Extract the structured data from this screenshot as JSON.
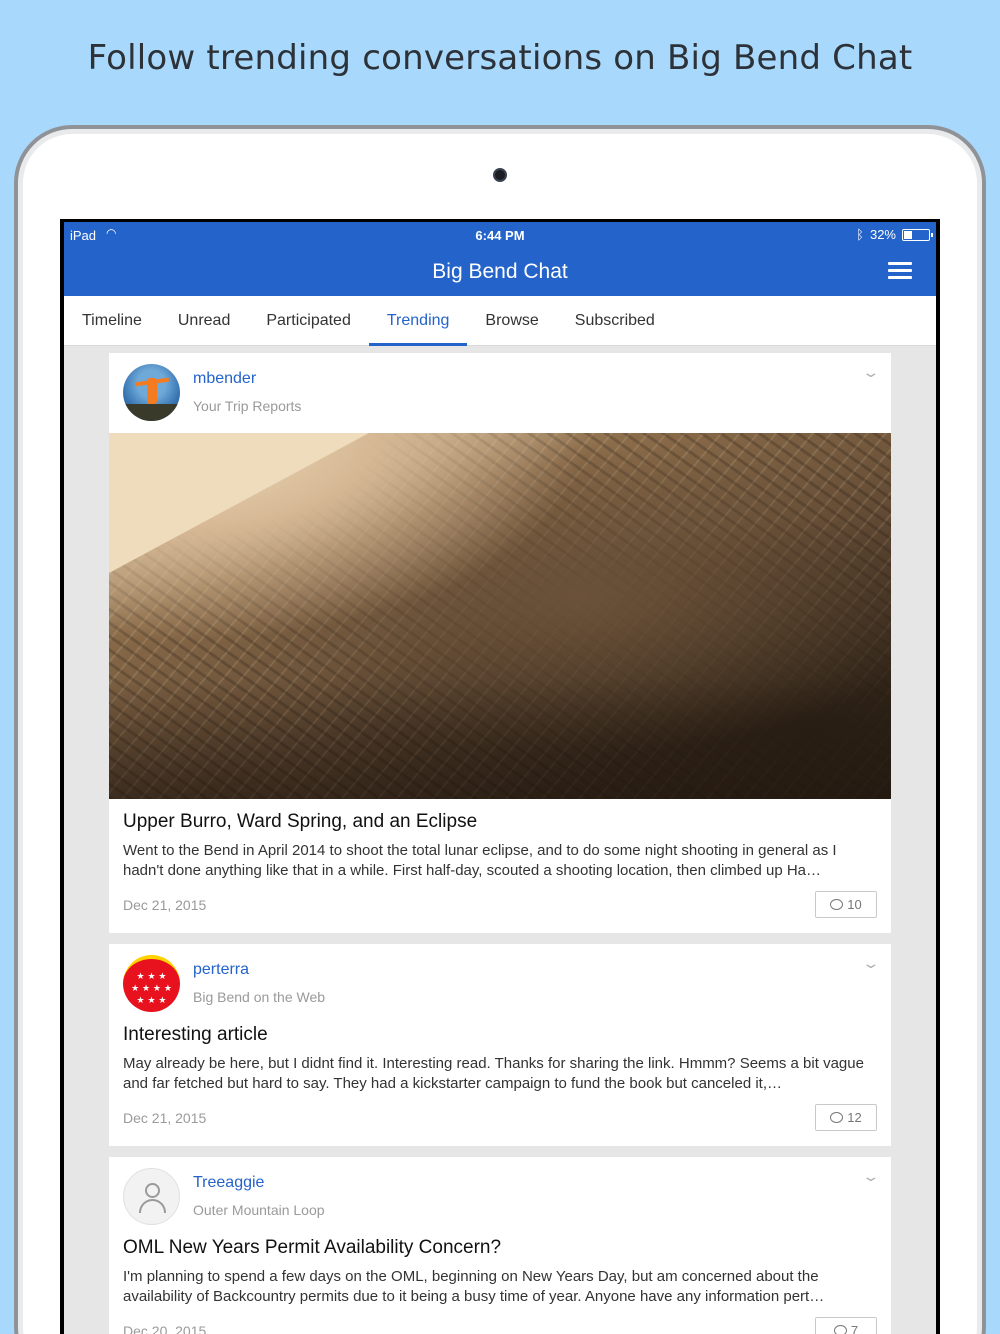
{
  "headline": "Follow trending conversations on Big Bend Chat",
  "status_bar": {
    "carrier": "iPad",
    "time": "6:44 PM",
    "battery": "32%",
    "battery_level": 0.32
  },
  "app": {
    "title": "Big Bend Chat"
  },
  "tabs": [
    {
      "label": "Timeline"
    },
    {
      "label": "Unread"
    },
    {
      "label": "Participated"
    },
    {
      "label": "Trending"
    },
    {
      "label": "Browse"
    },
    {
      "label": "Subscribed"
    }
  ],
  "active_tab": "Trending",
  "accent_color": "#2463c9",
  "posts": [
    {
      "username": "mbender",
      "forum": "Your Trip Reports",
      "title": "Upper Burro, Ward Spring, and an Eclipse",
      "excerpt": "Went to the Bend in April 2014 to shoot the total lunar eclipse, and to do some night shooting in general as I hadn't done anything like that in a while. First half-day, scouted a shooting location, then climbed up Ha…",
      "date": "Dec 21, 2015",
      "replies": "10"
    },
    {
      "username": "perterra",
      "forum": "Big Bend on the Web",
      "title": "Interesting article",
      "excerpt": "May already be here, but I didnt find it.   Interesting read. Thanks for sharing the link. Hmmm?  Seems a bit vague and far fetched but hard to say.  They had a kickstarter campaign to fund the book but canceled it,…",
      "date": "Dec 21, 2015",
      "replies": "12"
    },
    {
      "username": "Treeaggie",
      "forum": "Outer Mountain Loop",
      "title": "OML New Years Permit Availability  Concern?",
      "excerpt": "I'm planning to spend a few days on the OML, beginning on New Years Day, but am concerned about the availability of Backcountry permits due to it being a busy time of year. Anyone have any information pert…",
      "date": "Dec 20, 2015",
      "replies": "7"
    }
  ]
}
